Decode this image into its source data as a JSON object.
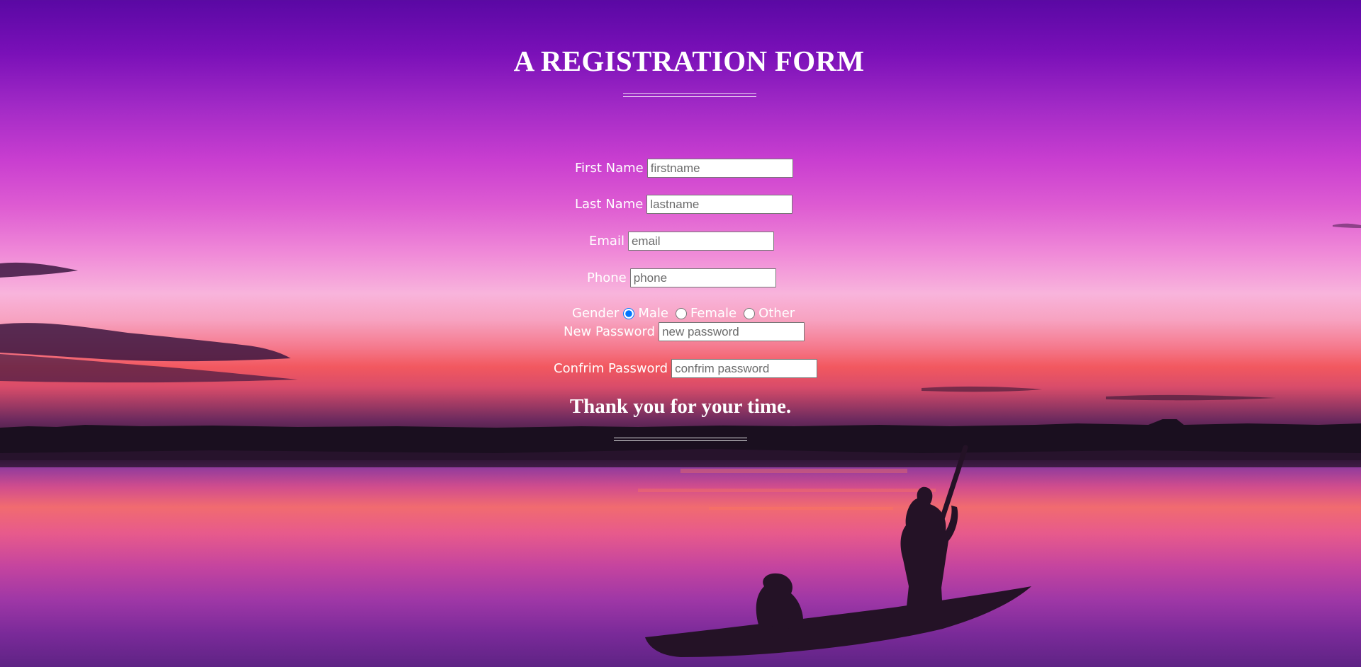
{
  "form": {
    "title": "A REGISTRATION FORM",
    "first_name": {
      "label": "First Name",
      "placeholder": "firstname",
      "value": ""
    },
    "last_name": {
      "label": "Last Name",
      "placeholder": "lastname",
      "value": ""
    },
    "email": {
      "label": "Email",
      "placeholder": "email",
      "value": ""
    },
    "phone": {
      "label": "Phone",
      "placeholder": "phone",
      "value": ""
    },
    "gender": {
      "label": "Gender",
      "options": [
        "Male",
        "Female",
        "Other"
      ],
      "selected": "Male"
    },
    "new_password": {
      "label": "New Password",
      "placeholder": "new password",
      "value": ""
    },
    "confirm_password": {
      "label": "Confrim Password",
      "placeholder": "confrim password",
      "value": ""
    },
    "footer_text": "Thank you for your time."
  },
  "colors": {
    "text": "#ffffff",
    "sky_top": "#5a08a4",
    "sky_mid": "#de5cd2",
    "sunset_glow": "#f2585f",
    "water": "#9e37a6",
    "radio_accent": "#0a6cff"
  }
}
